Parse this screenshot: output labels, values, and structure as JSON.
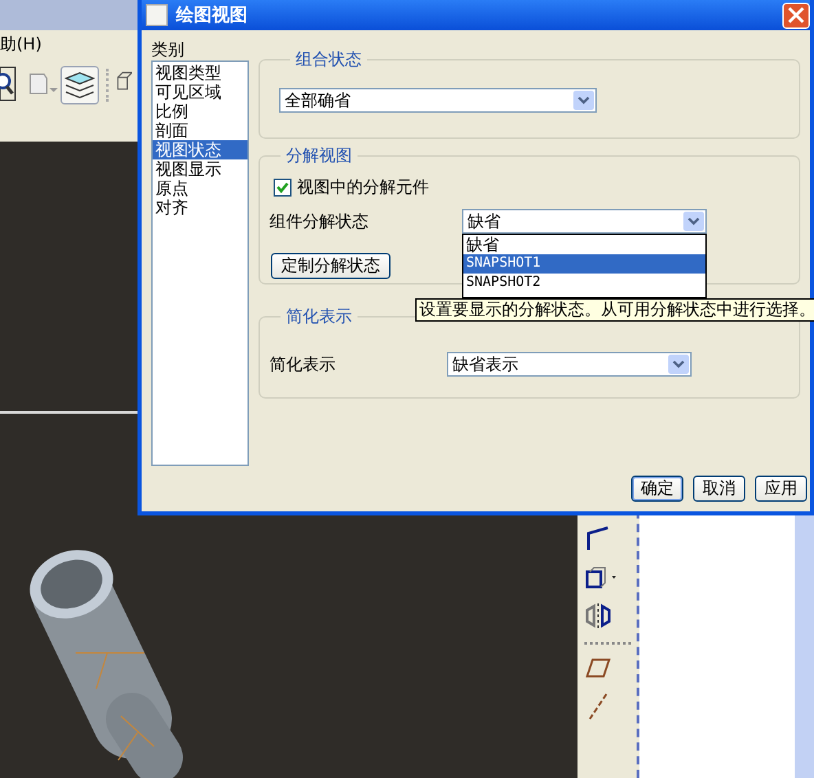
{
  "app": {
    "menu": [
      {
        "label": "助(H)"
      }
    ]
  },
  "dialog": {
    "title": "绘图视图",
    "category_label": "类别",
    "categories": [
      {
        "label": "视图类型",
        "selected": false
      },
      {
        "label": "可见区域",
        "selected": false
      },
      {
        "label": "比例",
        "selected": false
      },
      {
        "label": "剖面",
        "selected": false
      },
      {
        "label": "视图状态",
        "selected": true
      },
      {
        "label": "视图显示",
        "selected": false
      },
      {
        "label": "原点",
        "selected": false
      },
      {
        "label": "对齐",
        "selected": false
      }
    ],
    "combination_state": {
      "legend": "组合状态",
      "value": "全部确省"
    },
    "explode_view": {
      "legend": "分解视图",
      "checkbox": {
        "label": "视图中的分解元件",
        "checked": true
      },
      "state_label": "组件分解状态",
      "state_value": "缺省",
      "expanded": true,
      "state_options": [
        {
          "label": "缺省",
          "selected": false
        },
        {
          "label": "SNAPSHOT1",
          "selected": true
        },
        {
          "label": "SNAPSHOT2",
          "selected": false
        }
      ],
      "custom_button": "定制分解状态"
    },
    "tooltip": "设置要显示的分解状态。从可用分解状态中进行选择。",
    "simplified_rep": {
      "legend": "简化表示",
      "label": "简化表示",
      "value": "缺省表示"
    },
    "buttons": [
      "确定",
      "取消",
      "应用"
    ]
  }
}
